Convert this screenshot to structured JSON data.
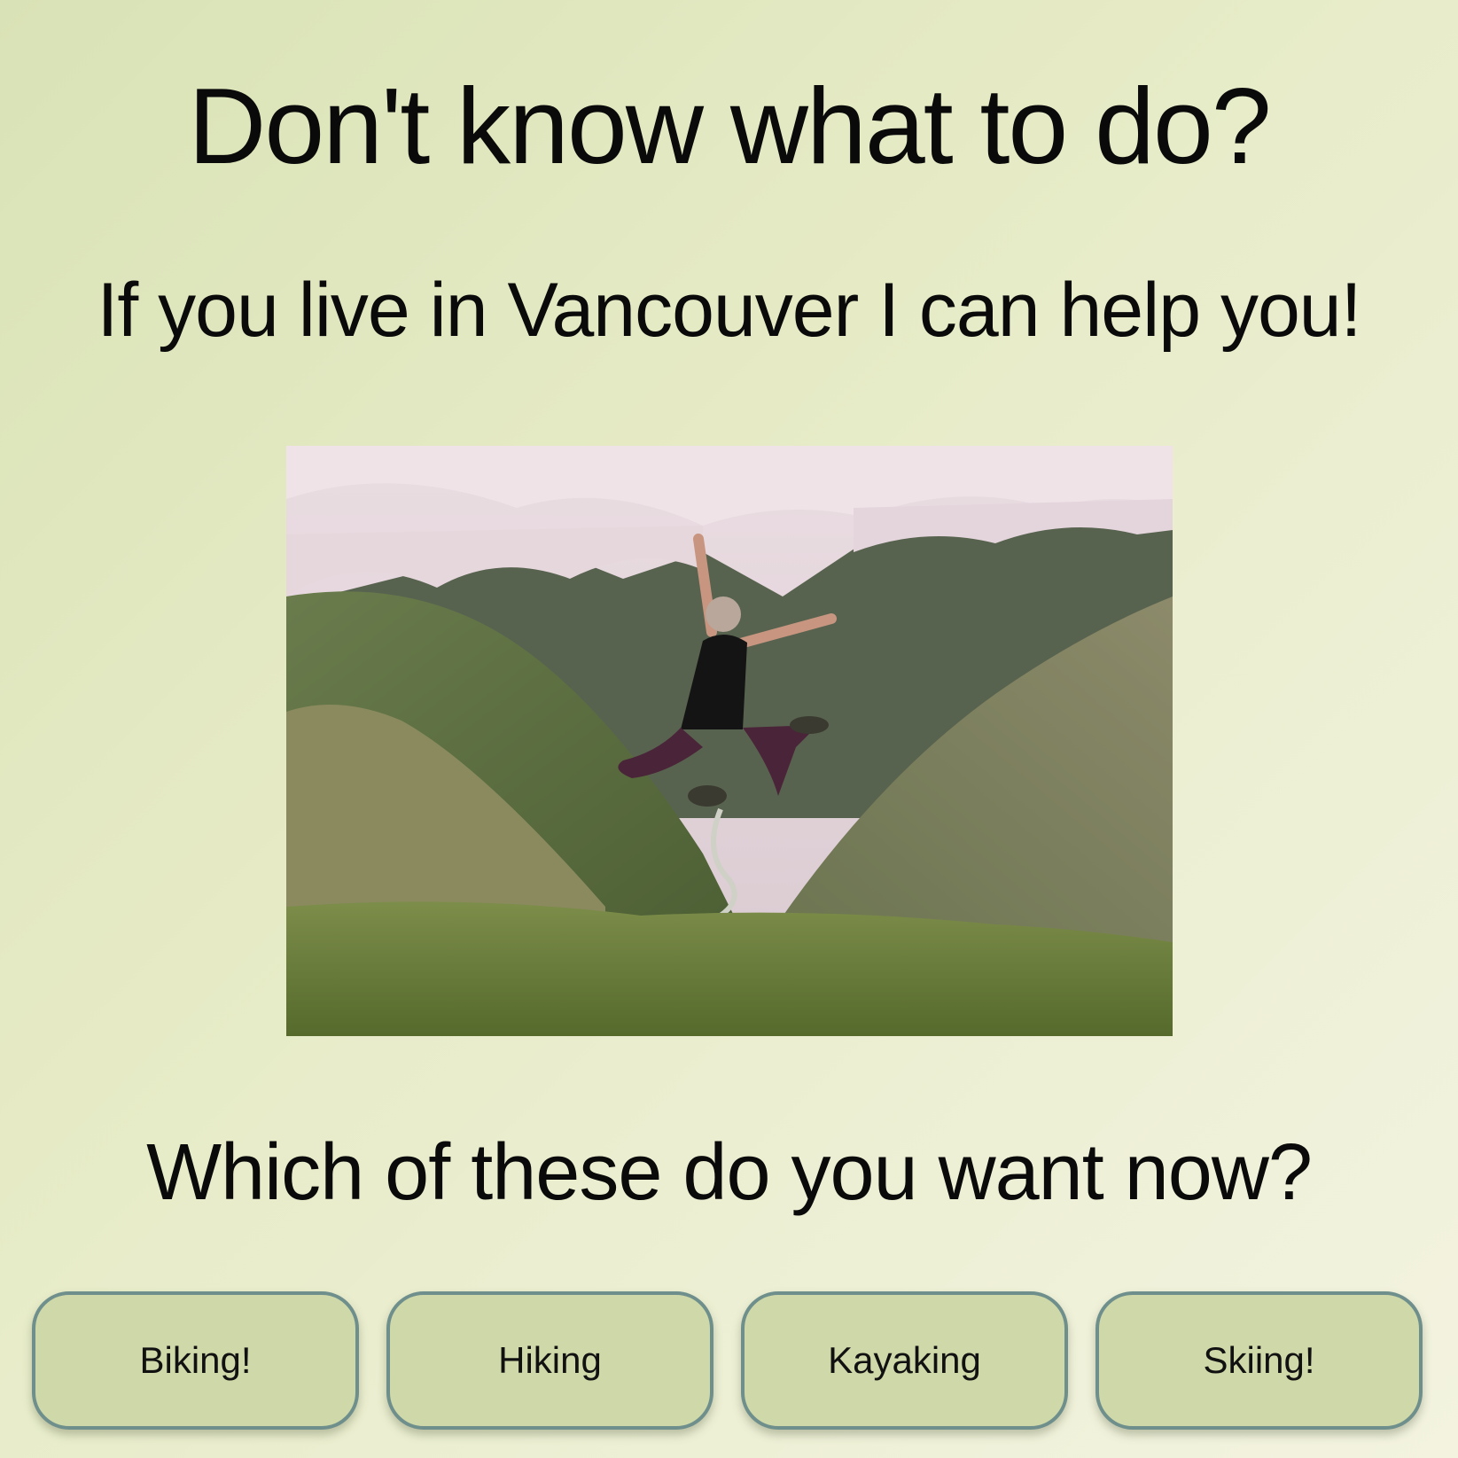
{
  "header": {
    "title": "Don't know what to do?",
    "subtitle": "If you live in Vancouver I can help you!"
  },
  "hero_image": {
    "alt": "Person jumping on a mountain ridge"
  },
  "prompt": {
    "question": "Which of these do you want now?"
  },
  "choices": [
    {
      "label": "Biking!"
    },
    {
      "label": "Hiking"
    },
    {
      "label": "Kayaking"
    },
    {
      "label": "Skiing!"
    }
  ],
  "colors": {
    "background": "#e6ebc6",
    "button_fill": "#cfd8a8",
    "button_border": "#6f8f8c"
  }
}
